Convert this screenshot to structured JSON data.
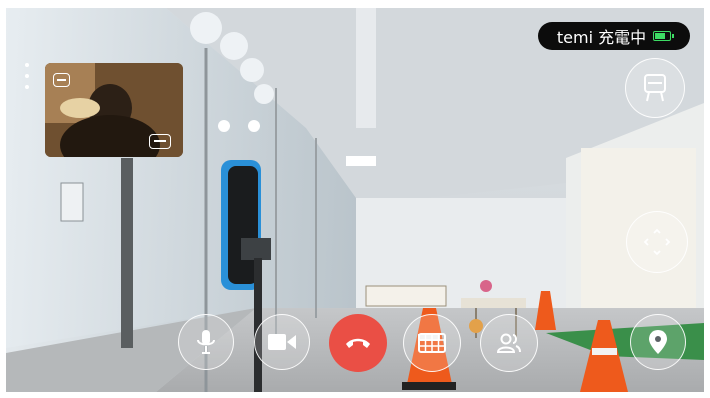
{
  "status": {
    "text": "temi 充電中",
    "battery_level": 0.8,
    "battery_color": "#3ddc64"
  },
  "remote_preview": {
    "icons": [
      "remote-minimize-icon",
      "remote-switch-icon"
    ]
  },
  "controls": {
    "accent_hangup": "#ea4f45",
    "buttons": [
      {
        "name": "mic-button",
        "icon": "microphone-icon"
      },
      {
        "name": "camera-button",
        "icon": "video-camera-icon"
      },
      {
        "name": "hang-up-button",
        "icon": "phone-hangup-icon"
      },
      {
        "name": "keypad-button",
        "icon": "keypad-icon"
      },
      {
        "name": "participants-button",
        "icon": "people-icon"
      },
      {
        "name": "location-button",
        "icon": "map-pin-icon"
      },
      {
        "name": "movement-button",
        "icon": "move-arrows-icon"
      },
      {
        "name": "robot-view-button",
        "icon": "robot-icon"
      }
    ]
  },
  "scene": {
    "description_icons": [
      "traffic-cone-icon",
      "robot-stand-icon"
    ]
  }
}
